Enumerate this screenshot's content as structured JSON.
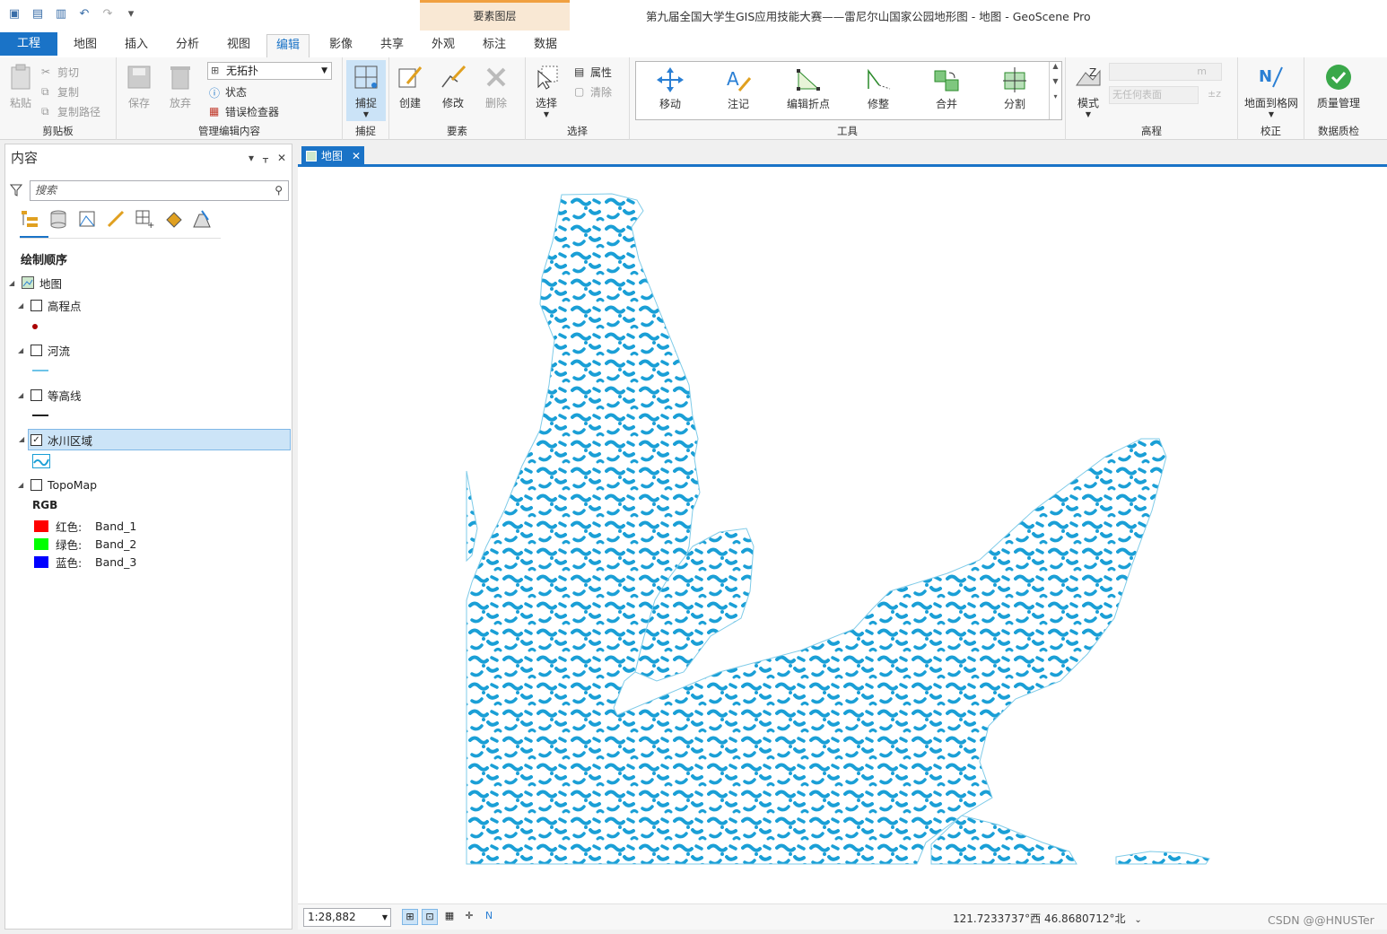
{
  "app": {
    "title": "第九届全国大学生GIS应用技能大赛——雷尼尔山国家公园地形图 - 地图 - GeoScene Pro",
    "context_tab_group": "要素图层",
    "watermark": "CSDN @@HNUSTer"
  },
  "tabs": [
    "工程",
    "地图",
    "插入",
    "分析",
    "视图",
    "编辑",
    "影像",
    "共享",
    "外观",
    "标注",
    "数据"
  ],
  "ribbon": {
    "clipboard": {
      "paste": "粘贴",
      "cut": "剪切",
      "copy": "复制",
      "copy_path": "复制路径",
      "label": "剪贴板"
    },
    "manage": {
      "save": "保存",
      "discard": "放弃",
      "topology": "无拓扑",
      "status": "状态",
      "error_inspector": "错误检查器",
      "label": "管理编辑内容"
    },
    "snap": {
      "snap": "捕捉",
      "label": "捕捉"
    },
    "features": {
      "create": "创建",
      "modify": "修改",
      "delete": "删除",
      "label": "要素"
    },
    "selection": {
      "select": "选择",
      "attributes": "属性",
      "clear": "清除",
      "label": "选择"
    },
    "tools": {
      "move": "移动",
      "annotate": "注记",
      "edit_vertices": "编辑折点",
      "reshape": "修整",
      "merge": "合并",
      "split": "分割",
      "label": "工具"
    },
    "elevation": {
      "mode": "模式",
      "unit": "m",
      "surface": "无任何表面",
      "label": "高程"
    },
    "correct": {
      "ground_to_grid": "地面到格网",
      "label": "校正"
    },
    "quality": {
      "data_quality": "质量管理",
      "label": "数据质检"
    }
  },
  "contents": {
    "title": "内容",
    "search_placeholder": "搜索",
    "drawing_order": "绘制顺序",
    "map": "地图",
    "layers": [
      {
        "name": "高程点",
        "checked": false
      },
      {
        "name": "河流",
        "checked": false
      },
      {
        "name": "等高线",
        "checked": false
      },
      {
        "name": "冰川区域",
        "checked": true
      },
      {
        "name": "TopoMap",
        "checked": false
      }
    ],
    "rgb_label": "RGB",
    "bands": [
      {
        "channel": "红色:",
        "band": "Band_1",
        "color": "#ff0000"
      },
      {
        "channel": "绿色:",
        "band": "Band_2",
        "color": "#00ff00"
      },
      {
        "channel": "蓝色:",
        "band": "Band_3",
        "color": "#0000ff"
      }
    ]
  },
  "map": {
    "tab_label": "地图",
    "scale": "1:28,882",
    "coordinates": "121.7233737°西 46.8680712°北",
    "glacier_color": "#1a9fd6"
  }
}
